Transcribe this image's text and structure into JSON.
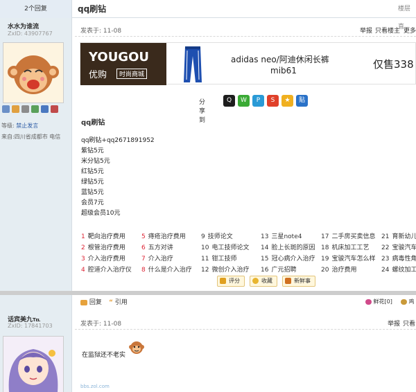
{
  "header": {
    "reply_count": "2个回复",
    "title": "qq刷钻",
    "right": "楼层直"
  },
  "post1": {
    "username": "水水为谁流",
    "zxid": "ZxID:  43907767",
    "level_label": "等级:",
    "level_value": "禁止发言",
    "from": "来自:四川省成都市 电信",
    "posted": "发表于: 11-08",
    "actions": [
      "举报",
      "只看楼主",
      "更多"
    ],
    "ad": {
      "brand": "YOUGOU",
      "brand_cn": "优购",
      "brand_tag": "时尚商城",
      "product": "adidas neo/阿迪休闲长裤",
      "code": "mib61",
      "price": "仅售338"
    },
    "share_label": "分享到",
    "content_title": "qq刷钻",
    "content_lines": [
      "qq刷钻+qq2671891952",
      "紫钻5元",
      "米分钻5元",
      "红钻5元",
      "绿钻5元",
      "蓝钻5元",
      "会员7元",
      "超级会员10元"
    ],
    "related": [
      [
        "1",
        "靶向治疗费用"
      ],
      [
        "5",
        "痔疮治疗费用"
      ],
      [
        "9",
        "技师论文"
      ],
      [
        "13",
        "三星note4"
      ],
      [
        "17",
        "二手房买卖信息"
      ],
      [
        "21",
        "育新幼儿"
      ],
      [
        "2",
        "根管治疗费用"
      ],
      [
        "6",
        "五方对讲"
      ],
      [
        "10",
        "电工技师论文"
      ],
      [
        "14",
        "脸上长斑的原因"
      ],
      [
        "18",
        "机床加工工艺"
      ],
      [
        "22",
        "宝骏汽车"
      ],
      [
        "3",
        "介入治疗费用"
      ],
      [
        "7",
        "介入治疗"
      ],
      [
        "11",
        "钳工技师"
      ],
      [
        "15",
        "冠心病介入治疗"
      ],
      [
        "19",
        "宝骏汽车怎么样"
      ],
      [
        "23",
        "病毒性角"
      ],
      [
        "4",
        "腔道介入治疗仪"
      ],
      [
        "8",
        "什么是介入治疗"
      ],
      [
        "12",
        "微创介入治疗"
      ],
      [
        "16",
        "广元招聘"
      ],
      [
        "20",
        "治疗费用"
      ],
      [
        "24",
        "螺纹加工"
      ]
    ],
    "buttons": [
      "评分",
      "收藏",
      "新鲜事"
    ],
    "reply_btn": "回复",
    "quote_btn": "引用",
    "flower": "鲜花[0]",
    "egg": "鸡"
  },
  "post2": {
    "username": "话宾美九℡",
    "zxid": "ZxID:  17841703",
    "posted": "发表于: 11-08",
    "actions": [
      "举报",
      "只看"
    ],
    "text": "在监狱还不老实",
    "watermark": "bbs.zol.com"
  }
}
